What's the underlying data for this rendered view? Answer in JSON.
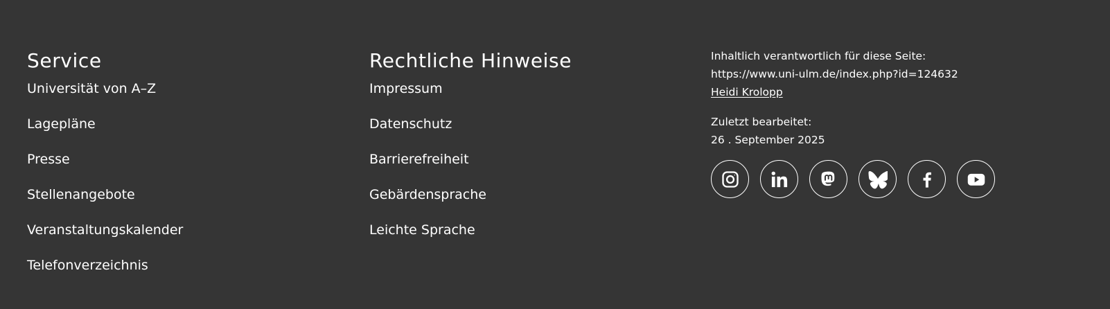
{
  "service": {
    "heading": "Service",
    "links": [
      {
        "label": "Universität von A–Z"
      },
      {
        "label": "Lagepläne"
      },
      {
        "label": "Presse"
      },
      {
        "label": "Stellenangebote"
      },
      {
        "label": "Veranstaltungskalender"
      },
      {
        "label": "Telefonverzeichnis"
      }
    ]
  },
  "legal": {
    "heading": "Rechtliche Hinweise",
    "links": [
      {
        "label": "Impressum"
      },
      {
        "label": "Datenschutz"
      },
      {
        "label": "Barrierefreiheit"
      },
      {
        "label": "Gebärdensprache"
      },
      {
        "label": "Leichte Sprache"
      }
    ]
  },
  "info": {
    "responsible_label": "Inhaltlich verantwortlich für diese Seite:",
    "page_url": "https://www.uni-ulm.de/index.php?id=124632",
    "contact_name": "Heidi Krolopp",
    "updated_label": "Zuletzt bearbeitet:",
    "updated_date": "26 . September 2025"
  },
  "social": [
    {
      "icon": "instagram-icon"
    },
    {
      "icon": "linkedin-icon"
    },
    {
      "icon": "mastodon-icon"
    },
    {
      "icon": "bluesky-icon"
    },
    {
      "icon": "facebook-icon"
    },
    {
      "icon": "youtube-icon"
    }
  ],
  "colors": {
    "background": "#353535",
    "text": "#ffffff"
  }
}
